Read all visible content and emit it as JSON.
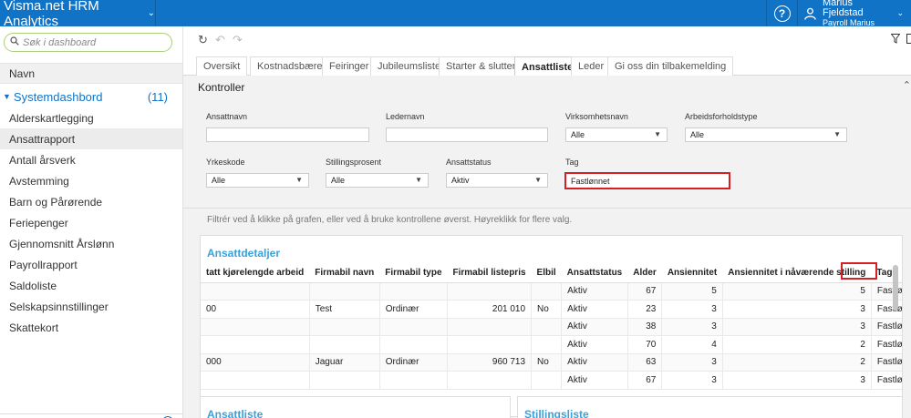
{
  "app": {
    "title": "Visma.net HRM Analytics"
  },
  "user": {
    "name": "Marius Fjeldstad",
    "role": "Payroll Marius"
  },
  "sidebar": {
    "search_placeholder": "Søk i dashboard",
    "header": "Navn",
    "group": {
      "label": "Systemdashbord",
      "count": "(11)"
    },
    "items": [
      {
        "label": "Alderskartlegging"
      },
      {
        "label": "Ansattrapport"
      },
      {
        "label": "Antall årsverk"
      },
      {
        "label": "Avstemming"
      },
      {
        "label": "Barn og Pårørende"
      },
      {
        "label": "Feriepenger"
      },
      {
        "label": "Gjennomsnitt Årslønn"
      },
      {
        "label": "Payrollrapport"
      },
      {
        "label": "Saldoliste"
      },
      {
        "label": "Selskapsinnstillinger"
      },
      {
        "label": "Skattekort"
      }
    ]
  },
  "tabs": [
    {
      "label": "Oversikt"
    },
    {
      "label": "Kostnadsbærere"
    },
    {
      "label": "Feiringer"
    },
    {
      "label": "Jubileumsliste"
    },
    {
      "label": "Starter & slutter"
    },
    {
      "label": "Ansattliste"
    },
    {
      "label": "Leder"
    },
    {
      "label": "Gi oss din tilbakemelding"
    }
  ],
  "active_tab": "Ansattliste",
  "kontroller": {
    "title": "Kontroller",
    "fields": {
      "ansattnavn": {
        "label": "Ansattnavn",
        "value": ""
      },
      "ledernavn": {
        "label": "Ledernavn",
        "value": ""
      },
      "virksomhetsnavn": {
        "label": "Virksomhetsnavn",
        "value": "Alle"
      },
      "arbeidsforholdstype": {
        "label": "Arbeidsforholdstype",
        "value": "Alle"
      },
      "yrkeskode": {
        "label": "Yrkeskode",
        "value": "Alle"
      },
      "stillingsprosent": {
        "label": "Stillingsprosent",
        "value": "Alle"
      },
      "ansattstatus": {
        "label": "Ansattstatus",
        "value": "Aktiv"
      },
      "tag": {
        "label": "Tag",
        "value": "Fastlønnet"
      }
    }
  },
  "hint": "Filtrér ved å klikke på grafen, eller ved å bruke kontrollene øverst. Høyreklikk for flere valg.",
  "ansattdetaljer": {
    "title": "Ansattdetaljer",
    "columns": [
      "tatt kjørelengde arbeid",
      "Firmabil navn",
      "Firmabil type",
      "Firmabil listepris",
      "Elbil",
      "Ansattstatus",
      "Alder",
      "Ansiennitet",
      "Ansiennitet i nåværende stilling",
      "Tags"
    ],
    "rows": [
      [
        "",
        "",
        "",
        "",
        "",
        "Aktiv",
        "67",
        "5",
        "5",
        "Fastlønnet"
      ],
      [
        "00",
        "Test",
        "Ordinær",
        "201 010",
        "No",
        "Aktiv",
        "23",
        "3",
        "3",
        "Fastlønnet"
      ],
      [
        "",
        "",
        "",
        "",
        "",
        "Aktiv",
        "38",
        "3",
        "3",
        "Fastlønnet"
      ],
      [
        "",
        "",
        "",
        "",
        "",
        "Aktiv",
        "70",
        "4",
        "2",
        "Fastlønnet"
      ],
      [
        "000",
        "Jaguar",
        "Ordinær",
        "960 713",
        "No",
        "Aktiv",
        "63",
        "3",
        "2",
        "Fastlønnet"
      ],
      [
        "",
        "",
        "",
        "",
        "",
        "Aktiv",
        "67",
        "3",
        "3",
        "Fastlønnet"
      ]
    ]
  },
  "bottom_panels": {
    "left": "Ansattliste",
    "right": "Stillingsliste"
  },
  "colors": {
    "topbar": "#1173c6",
    "accent_title": "#3ba1d8",
    "highlight": "#d32026"
  }
}
